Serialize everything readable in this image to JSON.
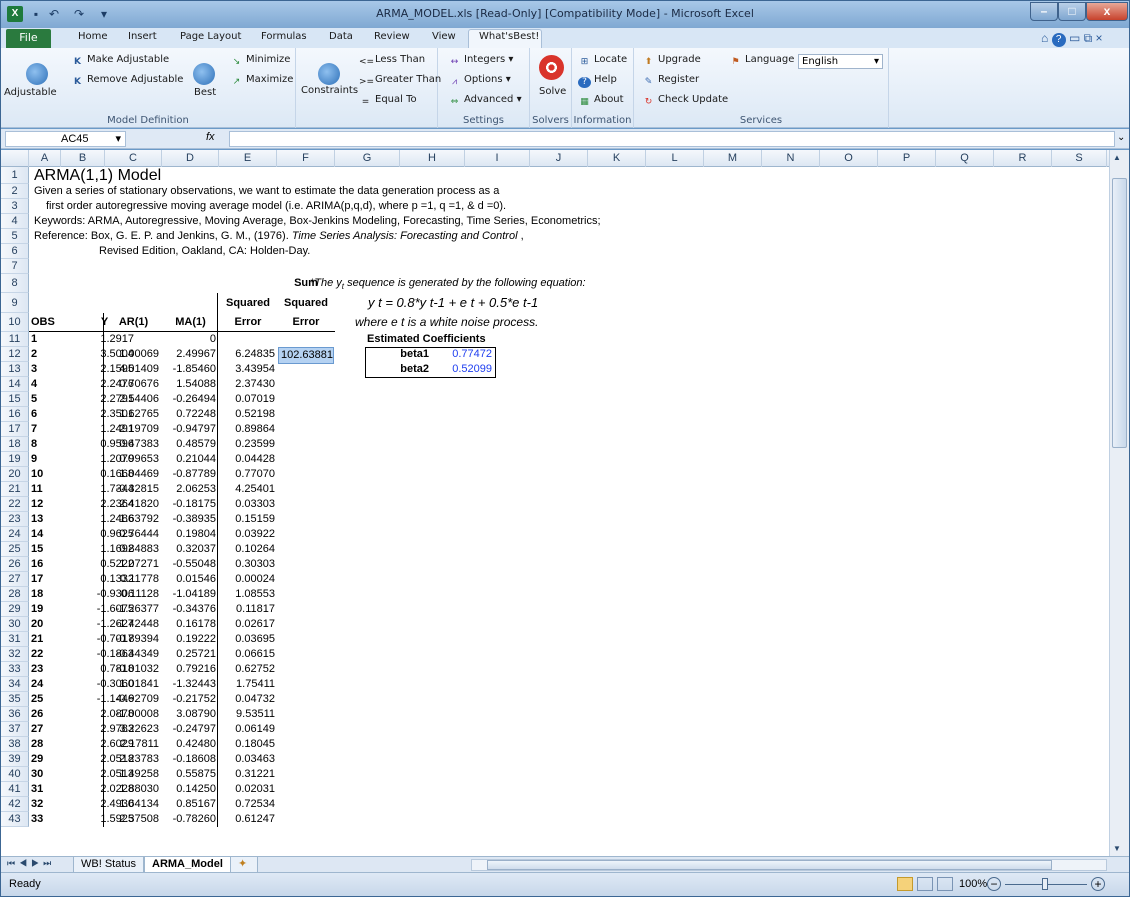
{
  "window": {
    "title": "ARMA_MODEL.xls  [Read-Only]  [Compatibility Mode]  -  Microsoft Excel",
    "min": "–",
    "max": "□",
    "close": "x"
  },
  "tabs": [
    "File",
    "Home",
    "Insert",
    "Page Layout",
    "Formulas",
    "Data",
    "Review",
    "View",
    "What'sBest!"
  ],
  "ribbon": {
    "adjustable": "Adjustable",
    "make_adjustable": "Make Adjustable",
    "remove_adjustable": "Remove Adjustable",
    "best": "Best",
    "minimize": "Minimize",
    "maximize": "Maximize",
    "constraints": "Constraints",
    "less_than": "Less Than",
    "greater_than": "Greater Than",
    "equal_to": "Equal To",
    "integers": "Integers",
    "options": "Options",
    "advanced": "Advanced",
    "solve": "Solve",
    "locate": "Locate",
    "help": "Help",
    "about": "About",
    "upgrade": "Upgrade",
    "register": "Register",
    "check_update": "Check Update",
    "language": "Language",
    "language_value": "English",
    "groups": {
      "model_definition": "Model Definition",
      "settings": "Settings",
      "solvers": "Solvers",
      "information": "Information",
      "services": "Services"
    },
    "colors": {
      "solve_ring": "#d9342b",
      "file_tab": "#2a7a3e"
    }
  },
  "formula_bar": {
    "name_box": "AC45",
    "fx": "fx",
    "content": ""
  },
  "columns": [
    "A",
    "B",
    "C",
    "D",
    "E",
    "F",
    "G",
    "H",
    "I",
    "J",
    "K",
    "L",
    "M",
    "N",
    "O",
    "P",
    "Q",
    "R",
    "S"
  ],
  "sheet": {
    "title": "ARMA(1,1) Model",
    "line2": "Given a series of stationary observations, we want to estimate the data generation process as a",
    "line3": "first order autoregressive moving average model  (i.e. ARIMA(p,q,d),  where p =1,  q =1, & d =0).",
    "line4": "Keywords: ARMA, Autoregressive, Moving Average, Box-Jenkins Modeling, Forecasting, Time Series, Econometrics;",
    "line5a": "Reference: Box, G. E. P. and Jenkins, G. M., (1976). ",
    "line5b": "Time Series Analysis: Forecasting and Control",
    "line5c": " ,",
    "line6": "Revised Edition, Oakland, CA: Holden-Day.",
    "sum_label": "Sum",
    "squared_label": "Squared",
    "error_label": "Error",
    "headers": {
      "obs": "OBS",
      "y": "Y",
      "ar": "AR(1)",
      "ma": "MA(1)"
    },
    "eq_note": "*The y",
    "eq_note_sub": "t",
    "eq_note_rest": " sequence is generated by the following equation:",
    "equation": "y t = 0.8*y t-1 + e t + 0.5*e t-1",
    "where_note": "where e t is a white noise process.",
    "coef_title": "Estimated Coefficients",
    "beta1_label": "beta1",
    "beta1_value": "0.77472",
    "beta2_label": "beta2",
    "beta2_value": "0.52099",
    "sum_value": "102.63881",
    "rows": [
      [
        "1",
        "1.2917",
        "",
        "0",
        ""
      ],
      [
        "2",
        "3.5004",
        "1.00069",
        "2.49967",
        "6.24835"
      ],
      [
        "3",
        "2.1595",
        "4.01409",
        "-1.85460",
        "3.43954"
      ],
      [
        "4",
        "2.2476",
        "0.70676",
        "1.54088",
        "2.37430"
      ],
      [
        "5",
        "2.2791",
        "2.54406",
        "-0.26494",
        "0.07019"
      ],
      [
        "6",
        "2.3501",
        "1.62765",
        "0.72248",
        "0.52198"
      ],
      [
        "7",
        "1.2491",
        "2.19709",
        "-0.94797",
        "0.89864"
      ],
      [
        "8",
        "0.9596",
        "0.47383",
        "0.48579",
        "0.23599"
      ],
      [
        "9",
        "1.2070",
        "0.99653",
        "0.21044",
        "0.04428"
      ],
      [
        "10",
        "0.1668",
        "1.04469",
        "-0.87789",
        "0.77070"
      ],
      [
        "11",
        "1.7344",
        "-0.32815",
        "2.06253",
        "4.25401"
      ],
      [
        "12",
        "2.2364",
        "2.41820",
        "-0.18175",
        "0.03303"
      ],
      [
        "13",
        "1.2486",
        "1.63792",
        "-0.38935",
        "0.15159"
      ],
      [
        "14",
        "0.9625",
        "0.76444",
        "0.19804",
        "0.03922"
      ],
      [
        "15",
        "1.1692",
        "0.84883",
        "0.32037",
        "0.10264"
      ],
      [
        "16",
        "0.5222",
        "1.07271",
        "-0.55048",
        "0.30303"
      ],
      [
        "17",
        "0.1332",
        "0.11778",
        "0.01546",
        "0.00024"
      ],
      [
        "18",
        "-0.9306",
        "0.11128",
        "-1.04189",
        "1.08553"
      ],
      [
        "19",
        "-1.6075",
        "-1.26377",
        "-0.34376",
        "0.11817"
      ],
      [
        "20",
        "-1.2627",
        "-1.42448",
        "0.16178",
        "0.02617"
      ],
      [
        "21",
        "-0.7017",
        "-0.89394",
        "0.19222",
        "0.03695"
      ],
      [
        "22",
        "-0.1863",
        "-0.44349",
        "0.25721",
        "0.06615"
      ],
      [
        "23",
        "0.7818",
        "-0.01032",
        "0.79216",
        "0.62752"
      ],
      [
        "24",
        "-0.3060",
        "1.01841",
        "-1.32443",
        "1.75411"
      ],
      [
        "25",
        "-1.1446",
        "-0.92709",
        "-0.21752",
        "0.04732"
      ],
      [
        "26",
        "2.0878",
        "-1.00008",
        "3.08790",
        "9.53511"
      ],
      [
        "27",
        "2.9783",
        "3.22623",
        "-0.24797",
        "0.06149"
      ],
      [
        "28",
        "2.6029",
        "2.17811",
        "0.42480",
        "0.18045"
      ],
      [
        "29",
        "2.0518",
        "2.23783",
        "-0.18608",
        "0.03463"
      ],
      [
        "30",
        "2.0513",
        "1.49258",
        "0.55875",
        "0.31221"
      ],
      [
        "31",
        "2.0228",
        "1.88030",
        "0.14250",
        "0.02031"
      ],
      [
        "32",
        "2.4930",
        "1.64134",
        "0.85167",
        "0.72534"
      ],
      [
        "33",
        "1.5925",
        "2.37508",
        "-0.78260",
        "0.61247"
      ]
    ]
  },
  "sheet_tabs": [
    "WB! Status",
    "ARMA_Model"
  ],
  "status": {
    "ready": "Ready",
    "zoom": "100%"
  }
}
